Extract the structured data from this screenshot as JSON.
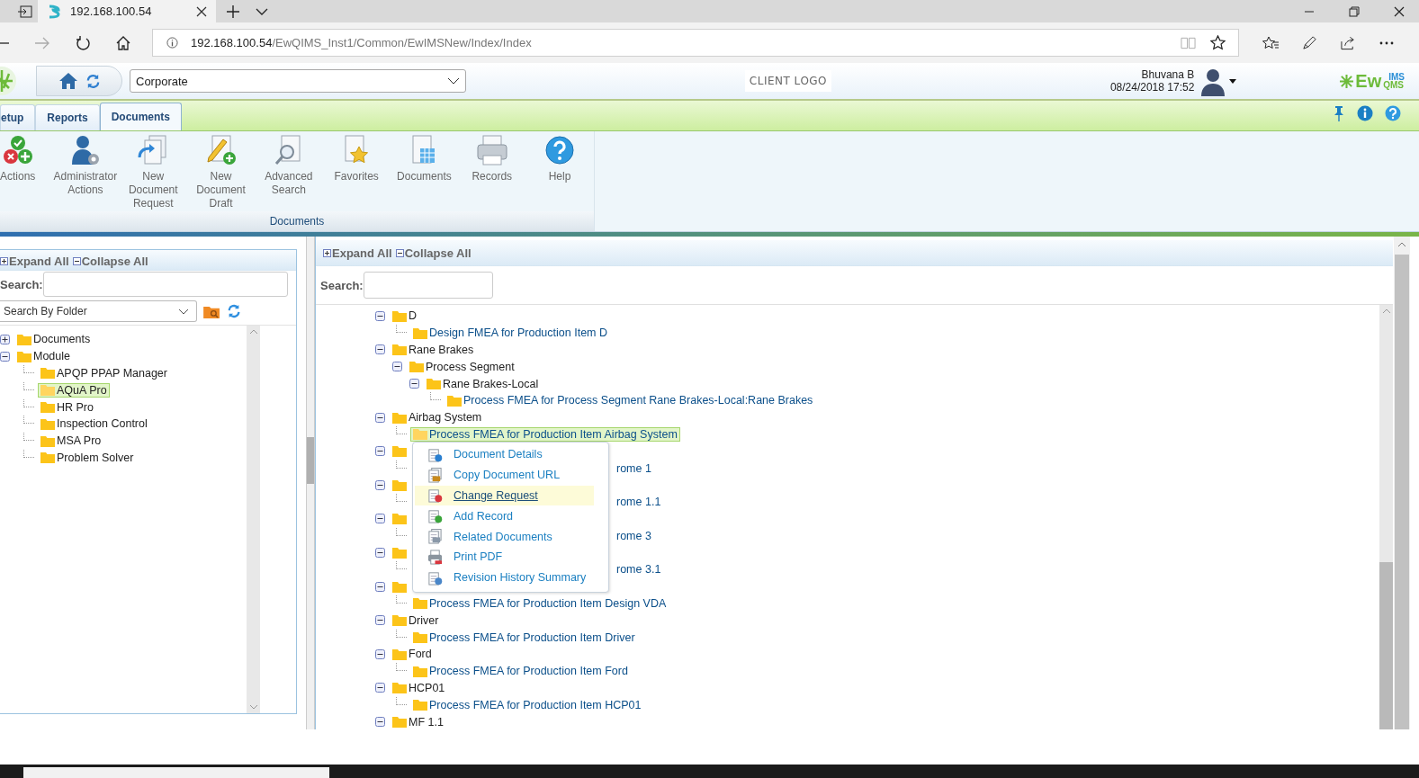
{
  "browser": {
    "tab_title": "192.168.100.54",
    "url_host": "192.168.100.54",
    "url_path": "/EwQIMS_Inst1/Common/EwIMSNew/Index/Index"
  },
  "header": {
    "site_select": "Corporate",
    "client_logo": "CLIENT LOGO",
    "user_name": "Bhuvana B",
    "datetime": "08/24/2018 17:52",
    "brand": "Ew",
    "brand_sup": "IMS",
    "brand_sub": "QMS"
  },
  "tabs": [
    {
      "label": "etup",
      "selected": false
    },
    {
      "label": "Reports",
      "selected": false
    },
    {
      "label": "Documents",
      "selected": true
    }
  ],
  "ribbon": {
    "group": "Documents",
    "items": [
      {
        "label": "Actions"
      },
      {
        "label": "Administrator Actions"
      },
      {
        "label": "New Document Request"
      },
      {
        "label": "New Document Draft"
      },
      {
        "label": "Advanced Search"
      },
      {
        "label": "Favorites"
      },
      {
        "label": "Documents"
      },
      {
        "label": "Records"
      },
      {
        "label": "Help"
      }
    ]
  },
  "left_panel": {
    "expand_all": "Expand All",
    "collapse_all": "Collapse All",
    "search_label": "Search:",
    "search_by": "Search By Folder",
    "tree": [
      {
        "label": "Documents",
        "kind": "folder",
        "expanded": false,
        "selected": false
      },
      {
        "label": "Module",
        "kind": "folder",
        "expanded": true,
        "selected": false,
        "children": [
          {
            "label": "APQP PPAP Manager",
            "kind": "folder",
            "selected": false
          },
          {
            "label": "AQuA Pro",
            "kind": "folder",
            "selected": true
          },
          {
            "label": "HR Pro",
            "kind": "folder",
            "selected": false
          },
          {
            "label": "Inspection Control",
            "kind": "folder",
            "selected": false
          },
          {
            "label": "MSA Pro",
            "kind": "folder",
            "selected": false
          },
          {
            "label": "Problem Solver",
            "kind": "folder",
            "selected": false
          }
        ]
      }
    ]
  },
  "right_panel": {
    "expand_all": "Expand All",
    "collapse_all": "Collapse All",
    "search_label": "Search:",
    "tree": [
      {
        "label": "D",
        "kind": "folder",
        "expanded": true,
        "selected": false,
        "children": [
          {
            "label": "Design FMEA for Production Item D",
            "kind": "document",
            "selected": false
          }
        ]
      },
      {
        "label": "Rane Brakes",
        "kind": "folder",
        "expanded": true,
        "selected": false,
        "children": [
          {
            "label": "Process Segment",
            "kind": "folder",
            "expanded": true,
            "selected": false,
            "children": [
              {
                "label": "Rane Brakes-Local",
                "kind": "folder",
                "expanded": true,
                "selected": false,
                "children": [
                  {
                    "label": "Process FMEA for Process Segment Rane Brakes-Local:Rane Brakes",
                    "kind": "document",
                    "selected": false
                  }
                ]
              }
            ]
          }
        ]
      },
      {
        "label": "Airbag System",
        "kind": "folder",
        "expanded": true,
        "selected": false,
        "children": [
          {
            "label": "Process FMEA for Production Item Airbag System",
            "kind": "document",
            "selected": true
          }
        ]
      },
      {
        "kind": "folder",
        "expanded": true,
        "selected": false,
        "children": [
          {
            "label": "rome 1",
            "kind": "document",
            "selected": false,
            "covered": true
          }
        ]
      },
      {
        "kind": "folder",
        "expanded": true,
        "selected": false,
        "children": [
          {
            "label": "rome 1.1",
            "kind": "document",
            "selected": false,
            "covered": true
          }
        ]
      },
      {
        "kind": "folder",
        "expanded": true,
        "selected": false,
        "children": [
          {
            "label": "rome 3",
            "kind": "document",
            "selected": false,
            "covered": true
          }
        ]
      },
      {
        "kind": "folder",
        "expanded": true,
        "selected": false,
        "children": [
          {
            "label": "rome 3.1",
            "kind": "document",
            "selected": false,
            "covered": true
          }
        ]
      },
      {
        "kind": "folder",
        "expanded": true,
        "selected": false,
        "children": [
          {
            "label": "Process FMEA for Production Item Design VDA",
            "kind": "document",
            "selected": false
          }
        ]
      },
      {
        "label": "Driver",
        "kind": "folder",
        "expanded": true,
        "selected": false,
        "children": [
          {
            "label": "Process FMEA for Production Item Driver",
            "kind": "document",
            "selected": false
          }
        ]
      },
      {
        "label": "Ford",
        "kind": "folder",
        "expanded": true,
        "selected": false,
        "children": [
          {
            "label": "Process FMEA for Production Item Ford",
            "kind": "document",
            "selected": false
          }
        ]
      },
      {
        "label": "HCP01",
        "kind": "folder",
        "expanded": true,
        "selected": false,
        "children": [
          {
            "label": "Process FMEA for Production Item HCP01",
            "kind": "document",
            "selected": false
          }
        ]
      },
      {
        "label": "MF 1.1",
        "kind": "folder",
        "expanded": true,
        "selected": false
      }
    ]
  },
  "context_menu": [
    {
      "label": "Document Details",
      "selected": false
    },
    {
      "label": "Copy Document URL",
      "selected": false
    },
    {
      "label": "Change Request",
      "selected": true
    },
    {
      "label": "Add Record",
      "selected": false
    },
    {
      "label": "Related Documents",
      "selected": false
    },
    {
      "label": "Print PDF",
      "selected": false
    },
    {
      "label": "Revision History Summary",
      "selected": false
    }
  ]
}
